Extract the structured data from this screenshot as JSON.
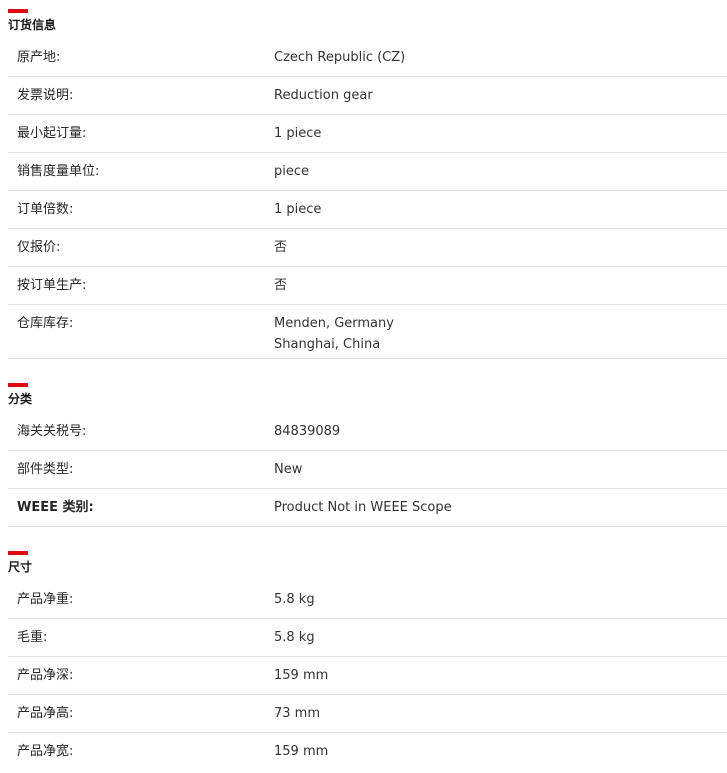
{
  "accent_color": "#e30613",
  "sections": [
    {
      "title": "订货信息",
      "rows": [
        {
          "label": "原产地:",
          "value": "Czech Republic (CZ)"
        },
        {
          "label": "发票说明:",
          "value": "Reduction gear"
        },
        {
          "label": "最小起订量:",
          "value": "1 piece"
        },
        {
          "label": "销售度量单位:",
          "value": "piece"
        },
        {
          "label": "订单倍数:",
          "value": "1 piece"
        },
        {
          "label": "仅报价:",
          "value": "否"
        },
        {
          "label": "按订单生产:",
          "value": "否"
        },
        {
          "label": "仓库库存:",
          "value_lines": [
            "Menden, Germany",
            "Shanghai, China"
          ]
        }
      ]
    },
    {
      "title": "分类",
      "rows": [
        {
          "label": "海关关税号:",
          "value": "84839089"
        },
        {
          "label": "部件类型:",
          "value": "New"
        },
        {
          "label": "WEEE 类别:",
          "value": "Product Not in WEEE Scope"
        }
      ]
    },
    {
      "title": "尺寸",
      "rows": [
        {
          "label": "产品净重:",
          "value": "5.8 kg"
        },
        {
          "label": "毛重:",
          "value": "5.8 kg"
        },
        {
          "label": "产品净深:",
          "value": "159 mm"
        },
        {
          "label": "产品净高:",
          "value": "73 mm"
        },
        {
          "label": "产品净宽:",
          "value": "159 mm"
        }
      ]
    }
  ]
}
